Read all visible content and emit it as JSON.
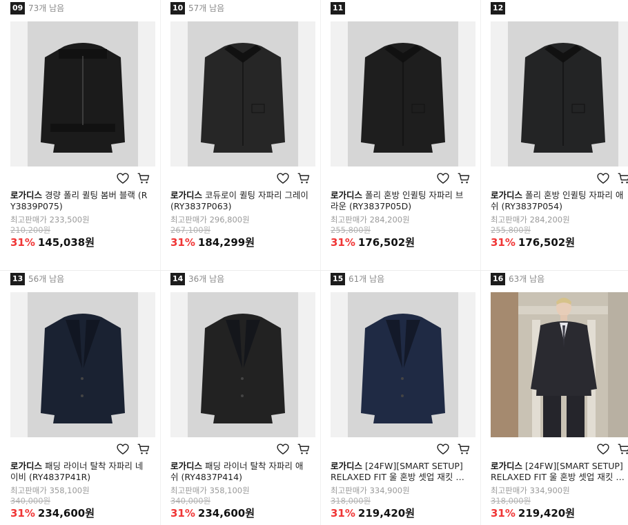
{
  "labels": {
    "max_price_prefix": "최고판매가"
  },
  "colors": {
    "discount": "#f03535",
    "rank_badge": "#1c1c1c",
    "image_bg": "#d6d6d6"
  },
  "icons": {
    "wishlist": "heart-icon",
    "cart": "cart-icon"
  },
  "products": [
    {
      "rank": "09",
      "stock": "73개 남음",
      "brand": "로가디스",
      "name": "경량 폴리 퀼팅 봄버 블랙 (RY3839P075)",
      "max_price": "233,500원",
      "original_price": "210,200원",
      "discount": "31%",
      "price": "145,038원"
    },
    {
      "rank": "10",
      "stock": "57개 남음",
      "brand": "로가디스",
      "name": "코듀로이 퀼팅 자파리 그레이 (RY3837P063)",
      "max_price": "296,800원",
      "original_price": "267,100원",
      "discount": "31%",
      "price": "184,299원"
    },
    {
      "rank": "11",
      "stock": "",
      "brand": "로가디스",
      "name": "폴리 혼방 인퀼팅 자파리 브라운 (RY3837P05D)",
      "max_price": "284,200원",
      "original_price": "255,800원",
      "discount": "31%",
      "price": "176,502원"
    },
    {
      "rank": "12",
      "stock": "",
      "brand": "로가디스",
      "name": "폴리 혼방 인퀼팅 자파리 애쉬 (RY3837P054)",
      "max_price": "284,200원",
      "original_price": "255,800원",
      "discount": "31%",
      "price": "176,502원"
    },
    {
      "rank": "13",
      "stock": "56개 남음",
      "brand": "로가디스",
      "name": "패딩 라이너 탈착 자파리 네이비 (RY4837P41R)",
      "max_price": "358,100원",
      "original_price": "340,000원",
      "discount": "31%",
      "price": "234,600원"
    },
    {
      "rank": "14",
      "stock": "36개 남음",
      "brand": "로가디스",
      "name": "패딩 라이너 탈착 자파리 애쉬 (RY4837P414)",
      "max_price": "358,100원",
      "original_price": "340,000원",
      "discount": "31%",
      "price": "234,600원"
    },
    {
      "rank": "15",
      "stock": "61개 남음",
      "brand": "로가디스",
      "name": "[24FW][SMART SETUP] RELAXED FIT 울 혼방 셋업 재킷 …",
      "max_price": "334,900원",
      "original_price": "318,000원",
      "discount": "31%",
      "price": "219,420원"
    },
    {
      "rank": "16",
      "stock": "63개 남음",
      "brand": "로가디스",
      "name": "[24FW][SMART SETUP] RELAXED FIT 울 혼방 셋업 재킷 …",
      "max_price": "334,900원",
      "original_price": "318,000원",
      "discount": "31%",
      "price": "219,420원"
    }
  ]
}
